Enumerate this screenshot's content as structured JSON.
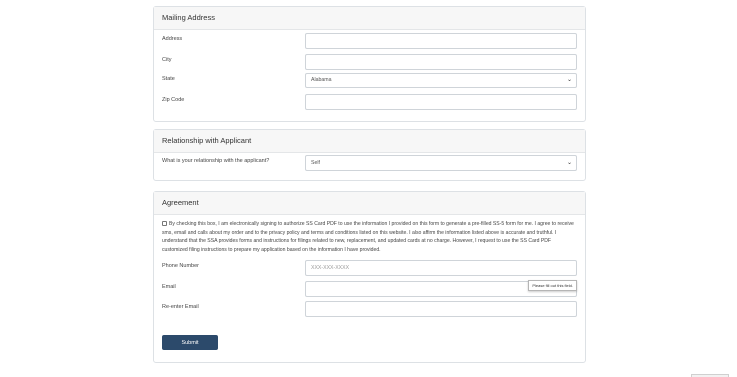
{
  "mailing": {
    "title": "Mailing Address",
    "address_label": "Address",
    "city_label": "City",
    "state_label": "State",
    "state_value": "Alabama",
    "zip_label": "Zip Code"
  },
  "relationship": {
    "title": "Relationship with Applicant",
    "question": "What is your relationship with the applicant?",
    "value": "Self"
  },
  "agreement": {
    "title": "Agreement",
    "consent_text": "By checking this box, I am electronically signing to authorize SS Card PDF to use the information I provided on this form to generate a pre-filled SS-5 form for me. I agree to receive sms, email and calls about my order and to the privacy policy and terms and conditions listed on this website. I also affirm the information listed above is accurate and truthful. I understand that the SSA provides forms and instructions for filings related to new, replacement, and updated cards at no charge. However, I request to use the SS Card PDF customized filing instructions to prepare my application based on the information I have provided.",
    "phone_label": "Phone Number",
    "phone_placeholder": "XXX-XXX-XXXX",
    "email_label": "Email",
    "tooltip": "Please fill out this field.",
    "reenter_label": "Re-enter Email",
    "submit_label": "Submit Application"
  }
}
